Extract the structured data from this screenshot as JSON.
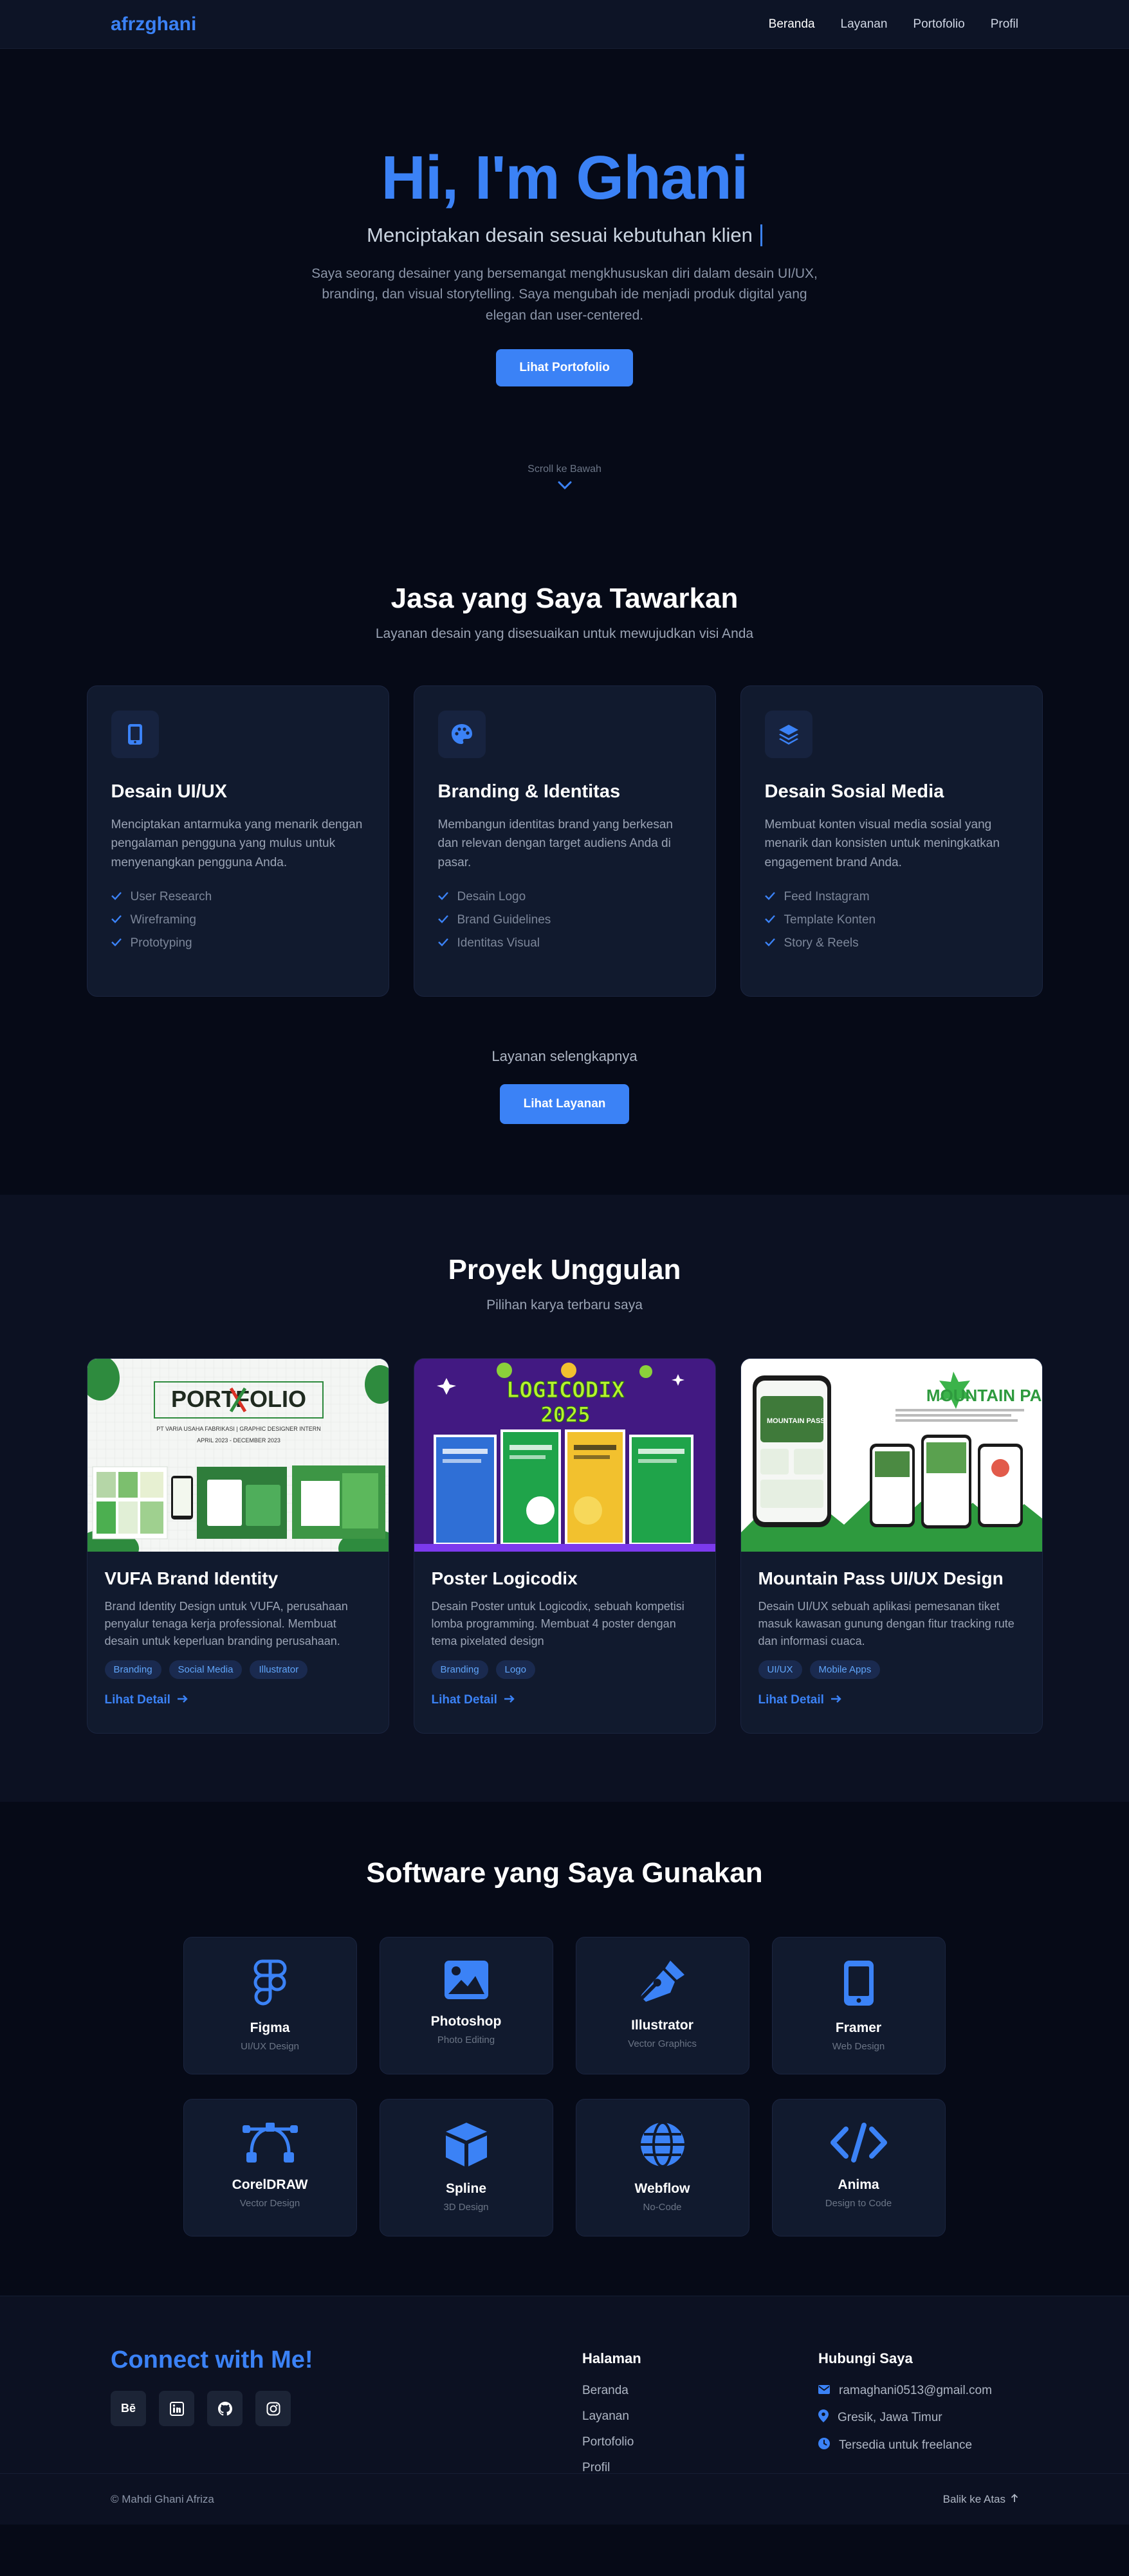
{
  "nav": {
    "brand": "afrzghani",
    "links": [
      "Beranda",
      "Layanan",
      "Portofolio",
      "Profil"
    ]
  },
  "hero": {
    "title": "Hi, I'm Ghani",
    "subtitle": "Menciptakan desain sesuai kebutuhan klien",
    "description": "Saya seorang desainer yang bersemangat mengkhususkan diri dalam desain UI/UX, branding, dan visual storytelling. Saya mengubah ide menjadi produk digital yang elegan dan user-centered.",
    "button": "Lihat Portofolio",
    "scroll": "Scroll ke Bawah"
  },
  "services": {
    "title": "Jasa yang Saya Tawarkan",
    "subtitle": "Layanan desain yang disesuaikan untuk mewujudkan visi Anda",
    "cards": [
      {
        "icon": "mobile-icon",
        "title": "Desain UI/UX",
        "desc": "Menciptakan antarmuka yang menarik dengan pengalaman pengguna yang mulus untuk menyenangkan pengguna Anda.",
        "items": [
          "User Research",
          "Wireframing",
          "Prototyping"
        ]
      },
      {
        "icon": "palette-icon",
        "title": "Branding & Identitas",
        "desc": "Membangun identitas brand yang berkesan dan relevan dengan target audiens Anda di pasar.",
        "items": [
          "Desain Logo",
          "Brand Guidelines",
          "Identitas Visual"
        ]
      },
      {
        "icon": "layers-icon",
        "title": "Desain Sosial Media",
        "desc": "Membuat konten visual media sosial yang menarik dan konsisten untuk meningkatkan engagement brand Anda.",
        "items": [
          "Feed Instagram",
          "Template Konten",
          "Story & Reels"
        ]
      }
    ],
    "more_label": "Layanan selengkapnya",
    "button": "Lihat Layanan"
  },
  "projects": {
    "title": "Proyek Unggulan",
    "subtitle": "Pilihan karya terbaru saya",
    "cards": [
      {
        "title": "VUFA Brand Identity",
        "desc": "Brand Identity Design untuk VUFA, perusahaan penyalur tenaga kerja professional. Membuat desain untuk keperluan branding perusahaan.",
        "tags": [
          "Branding",
          "Social Media",
          "Illustrator"
        ],
        "link": "Lihat Detail",
        "img_text": "PORTFOLIO",
        "img_line1": "PT VARIA USAHA FABRIKASI   |   GRAPHIC DESIGNER INTERN",
        "img_line2": "APRIL 2023 - DECEMBER 2023"
      },
      {
        "title": "Poster Logicodix",
        "desc": "Desain Poster untuk Logicodix, sebuah kompetisi lomba programming. Membuat 4 poster dengan tema pixelated design",
        "tags": [
          "Branding",
          "Logo"
        ],
        "link": "Lihat Detail",
        "img_text": "LOGICODIX",
        "img_line1": "2025"
      },
      {
        "title": "Mountain Pass UI/UX Design",
        "desc": "Desain UI/UX sebuah aplikasi pemesanan tiket masuk kawasan gunung dengan fitur tracking rute dan informasi cuaca.",
        "tags": [
          "UI/UX",
          "Mobile Apps"
        ],
        "link": "Lihat Detail",
        "img_text": "MOUNTAIN PASS",
        "img_line1": "MOUNTAIN PASS"
      }
    ]
  },
  "software": {
    "title": "Software yang Saya Gunakan",
    "items": [
      {
        "icon": "figma-icon",
        "name": "Figma",
        "sub": "UI/UX Design"
      },
      {
        "icon": "image-icon",
        "name": "Photoshop",
        "sub": "Photo Editing"
      },
      {
        "icon": "pen-nib-icon",
        "name": "Illustrator",
        "sub": "Vector Graphics"
      },
      {
        "icon": "mobile-icon",
        "name": "Framer",
        "sub": "Web Design"
      },
      {
        "icon": "bezier-icon",
        "name": "CorelDRAW",
        "sub": "Vector Design"
      },
      {
        "icon": "cube-icon",
        "name": "Spline",
        "sub": "3D Design"
      },
      {
        "icon": "globe-icon",
        "name": "Webflow",
        "sub": "No-Code"
      },
      {
        "icon": "code-icon",
        "name": "Anima",
        "sub": "Design to Code"
      }
    ]
  },
  "footer": {
    "connect": "Connect with Me!",
    "socials": [
      "Bē",
      "in",
      "github",
      "instagram"
    ],
    "pages_title": "Halaman",
    "pages": [
      "Beranda",
      "Layanan",
      "Portofolio",
      "Profil"
    ],
    "contact_title": "Hubungi Saya",
    "contact": [
      {
        "icon": "envelope-icon",
        "text": "ramaghani0513@gmail.com"
      },
      {
        "icon": "map-pin-icon",
        "text": "Gresik, Jawa Timur"
      },
      {
        "icon": "clock-icon",
        "text": "Tersedia untuk freelance"
      }
    ],
    "copyright": "© Mahdi Ghani Afriza",
    "back_top": "Balik ke Atas"
  },
  "colors": {
    "accent": "#3b82f6",
    "background": "#060a17",
    "card": "#111a2e"
  }
}
